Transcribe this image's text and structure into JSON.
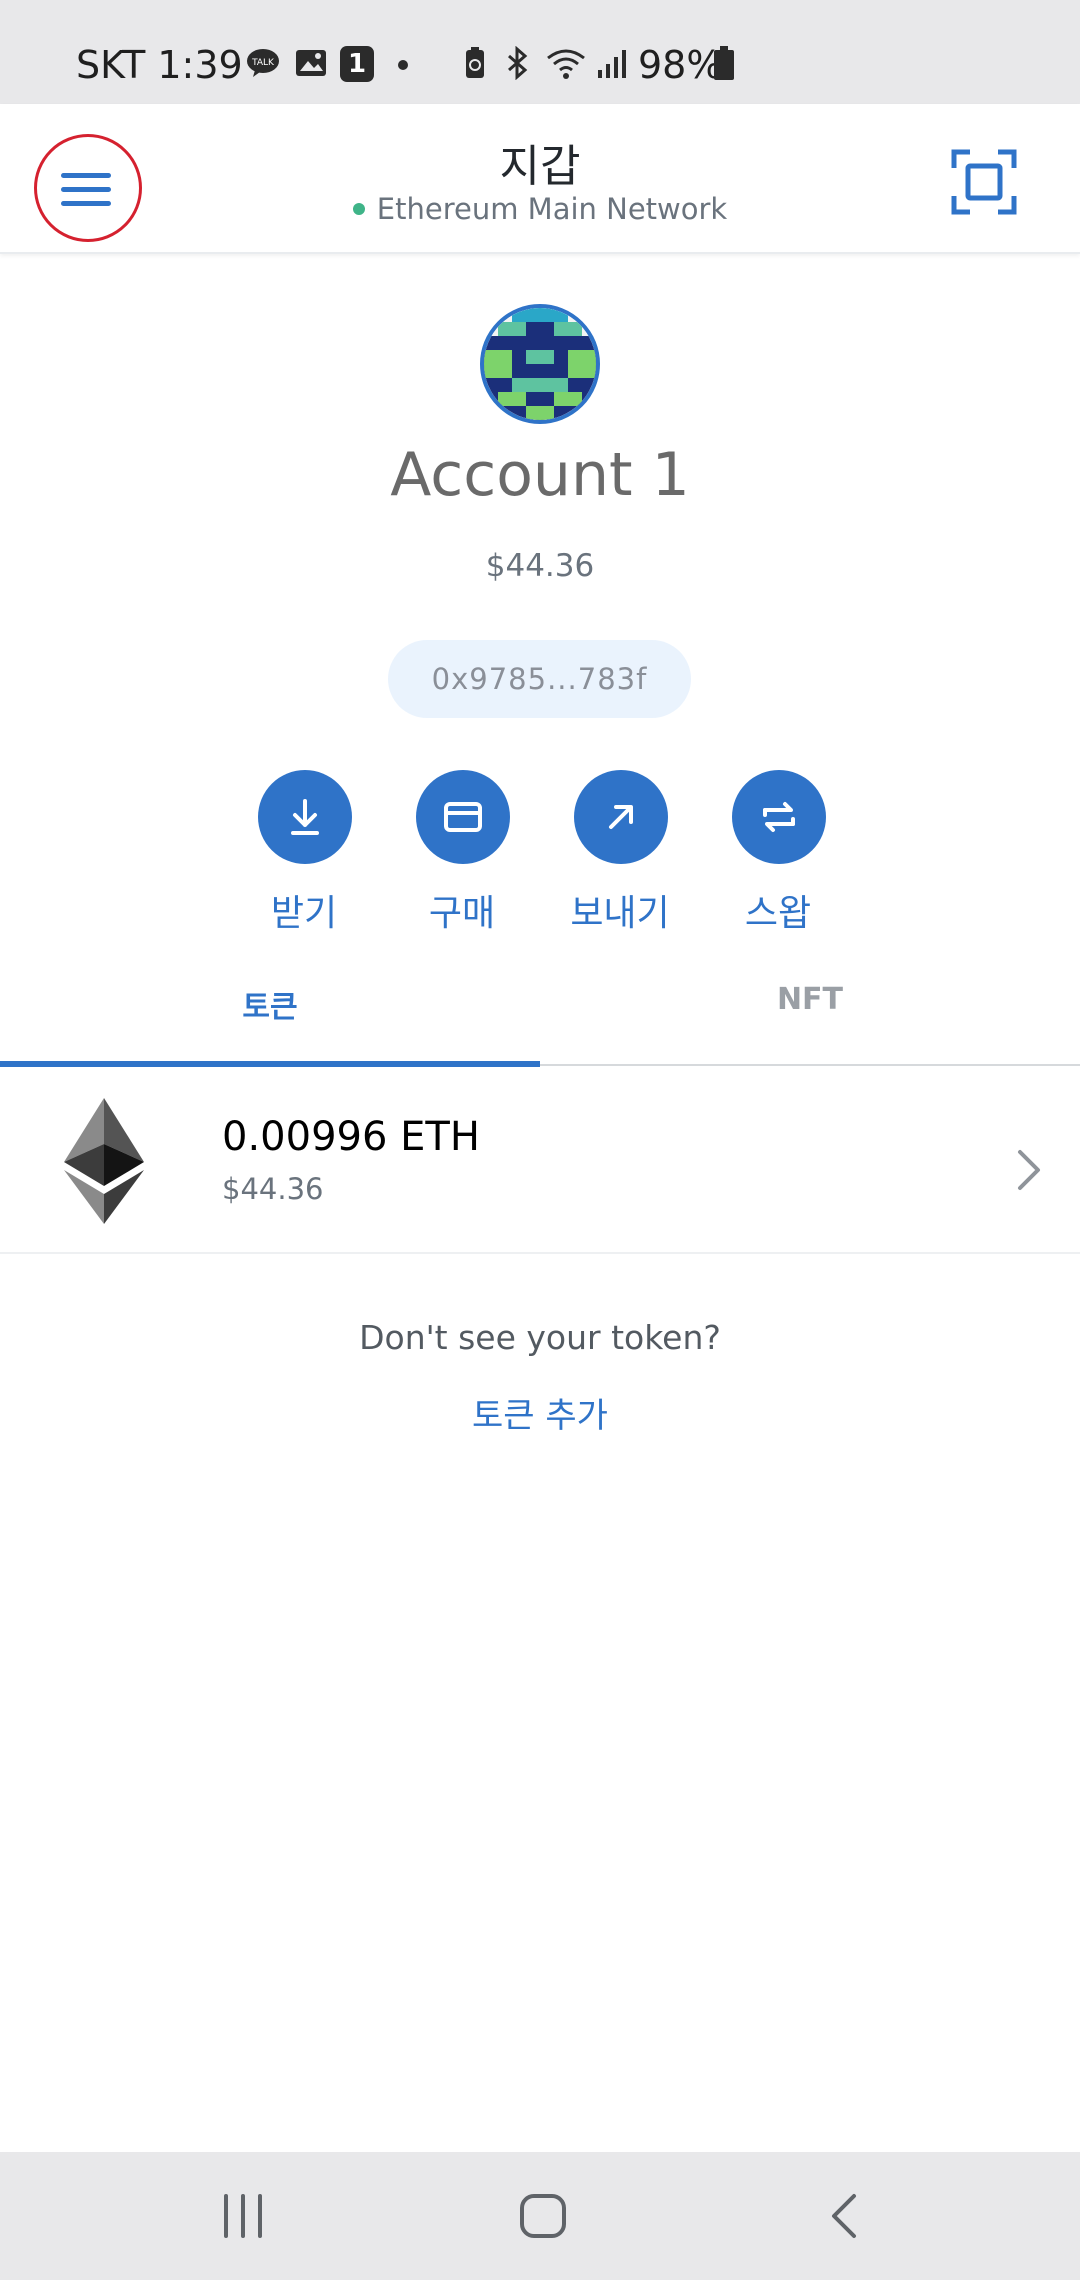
{
  "status_bar": {
    "carrier_time": "SKT 1:39",
    "notification_count": "1",
    "battery": "98%"
  },
  "header": {
    "title": "지갑",
    "network": "Ethereum Main Network"
  },
  "account": {
    "name": "Account 1",
    "balance": "$44.36",
    "address": "0x9785...783f"
  },
  "actions": [
    {
      "label": "받기",
      "icon": "download-icon"
    },
    {
      "label": "구매",
      "icon": "card-icon"
    },
    {
      "label": "보내기",
      "icon": "arrow-up-right-icon"
    },
    {
      "label": "스왑",
      "icon": "swap-icon"
    }
  ],
  "tabs": [
    {
      "label": "토큰",
      "active": true
    },
    {
      "label": "NFT",
      "active": false
    }
  ],
  "tokens": [
    {
      "amount": "0.00996 ETH",
      "fiat": "$44.36",
      "icon": "ethereum-icon"
    }
  ],
  "footer": {
    "prompt": "Don't see your token?",
    "add_token": "토큰 추가"
  },
  "colors": {
    "accent": "#2f73c8",
    "network_dot": "#3fb488",
    "highlight_circle": "#d5212f"
  }
}
